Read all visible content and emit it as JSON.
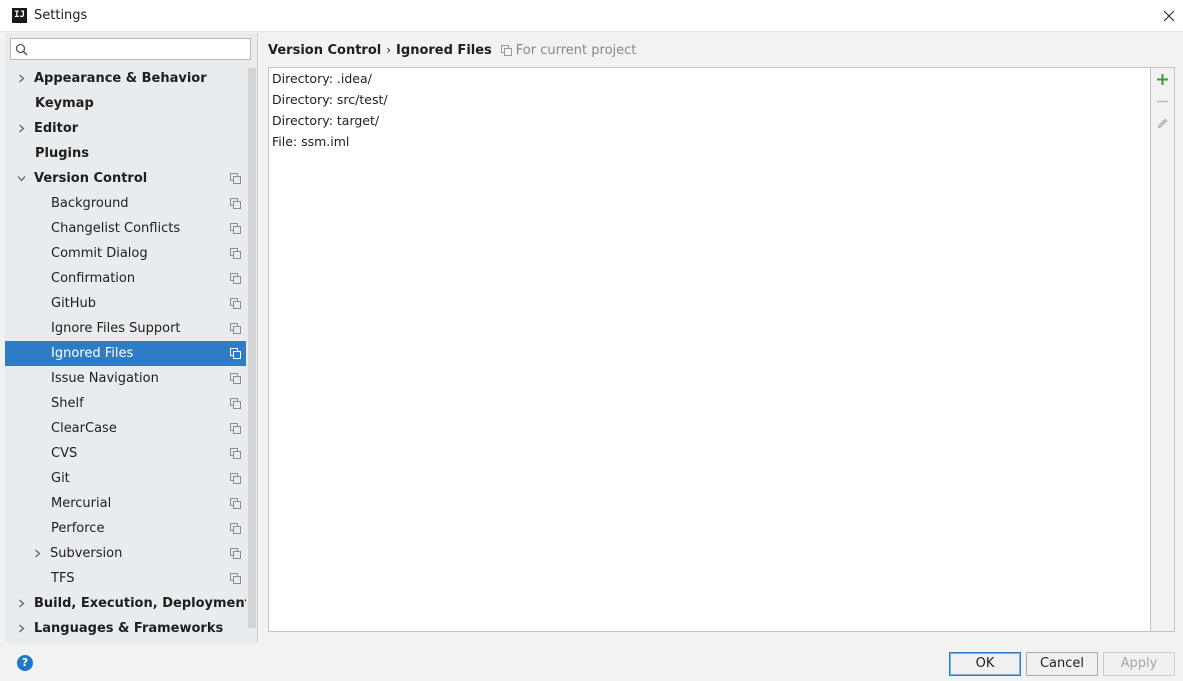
{
  "window": {
    "title": "Settings",
    "app_icon_text": "IJ"
  },
  "search": {
    "value": "",
    "placeholder": ""
  },
  "tree": [
    {
      "label": "Appearance & Behavior",
      "bold": true,
      "level": 0,
      "arrow": "right",
      "copy": false,
      "selected": false,
      "name": "tree-item-appearance-behavior"
    },
    {
      "label": "Keymap",
      "bold": true,
      "level": 0,
      "arrow": "none",
      "copy": false,
      "selected": false,
      "name": "tree-item-keymap"
    },
    {
      "label": "Editor",
      "bold": true,
      "level": 0,
      "arrow": "right",
      "copy": false,
      "selected": false,
      "name": "tree-item-editor"
    },
    {
      "label": "Plugins",
      "bold": true,
      "level": 0,
      "arrow": "none",
      "copy": false,
      "selected": false,
      "name": "tree-item-plugins"
    },
    {
      "label": "Version Control",
      "bold": true,
      "level": 0,
      "arrow": "down",
      "copy": true,
      "selected": false,
      "name": "tree-item-version-control"
    },
    {
      "label": "Background",
      "bold": false,
      "level": 1,
      "arrow": "none",
      "copy": true,
      "selected": false,
      "name": "tree-item-background"
    },
    {
      "label": "Changelist Conflicts",
      "bold": false,
      "level": 1,
      "arrow": "none",
      "copy": true,
      "selected": false,
      "name": "tree-item-changelist-conflicts"
    },
    {
      "label": "Commit Dialog",
      "bold": false,
      "level": 1,
      "arrow": "none",
      "copy": true,
      "selected": false,
      "name": "tree-item-commit-dialog"
    },
    {
      "label": "Confirmation",
      "bold": false,
      "level": 1,
      "arrow": "none",
      "copy": true,
      "selected": false,
      "name": "tree-item-confirmation"
    },
    {
      "label": "GitHub",
      "bold": false,
      "level": 1,
      "arrow": "none",
      "copy": true,
      "selected": false,
      "name": "tree-item-github"
    },
    {
      "label": "Ignore Files Support",
      "bold": false,
      "level": 1,
      "arrow": "none",
      "copy": true,
      "selected": false,
      "name": "tree-item-ignore-files-support"
    },
    {
      "label": "Ignored Files",
      "bold": false,
      "level": 1,
      "arrow": "none",
      "copy": true,
      "selected": true,
      "name": "tree-item-ignored-files"
    },
    {
      "label": "Issue Navigation",
      "bold": false,
      "level": 1,
      "arrow": "none",
      "copy": true,
      "selected": false,
      "name": "tree-item-issue-navigation"
    },
    {
      "label": "Shelf",
      "bold": false,
      "level": 1,
      "arrow": "none",
      "copy": true,
      "selected": false,
      "name": "tree-item-shelf"
    },
    {
      "label": "ClearCase",
      "bold": false,
      "level": 1,
      "arrow": "none",
      "copy": true,
      "selected": false,
      "name": "tree-item-clearcase"
    },
    {
      "label": "CVS",
      "bold": false,
      "level": 1,
      "arrow": "none",
      "copy": true,
      "selected": false,
      "name": "tree-item-cvs"
    },
    {
      "label": "Git",
      "bold": false,
      "level": 1,
      "arrow": "none",
      "copy": true,
      "selected": false,
      "name": "tree-item-git"
    },
    {
      "label": "Mercurial",
      "bold": false,
      "level": 1,
      "arrow": "none",
      "copy": true,
      "selected": false,
      "name": "tree-item-mercurial"
    },
    {
      "label": "Perforce",
      "bold": false,
      "level": 1,
      "arrow": "none",
      "copy": true,
      "selected": false,
      "name": "tree-item-perforce"
    },
    {
      "label": "Subversion",
      "bold": false,
      "level": 1,
      "arrow": "right",
      "copy": true,
      "selected": false,
      "name": "tree-item-subversion"
    },
    {
      "label": "TFS",
      "bold": false,
      "level": 1,
      "arrow": "none",
      "copy": true,
      "selected": false,
      "name": "tree-item-tfs"
    },
    {
      "label": "Build, Execution, Deployment",
      "bold": true,
      "level": 0,
      "arrow": "right",
      "copy": false,
      "selected": false,
      "name": "tree-item-build-execution-deployment"
    },
    {
      "label": "Languages & Frameworks",
      "bold": true,
      "level": 0,
      "arrow": "right",
      "copy": false,
      "selected": false,
      "name": "tree-item-languages-frameworks"
    }
  ],
  "breadcrumb": {
    "parent": "Version Control",
    "separator": "›",
    "current": "Ignored Files",
    "scope": "For current project"
  },
  "ignored_files": [
    "Directory: .idea/",
    "Directory: src/test/",
    "Directory: target/",
    "File: ssm.iml"
  ],
  "colors": {
    "selection": "#2f7bc6",
    "add_icon": "#3c9a3c",
    "help": "#1f77c9"
  },
  "footer": {
    "help_label": "?",
    "ok_label": "OK",
    "cancel_label": "Cancel",
    "apply_label": "Apply"
  }
}
